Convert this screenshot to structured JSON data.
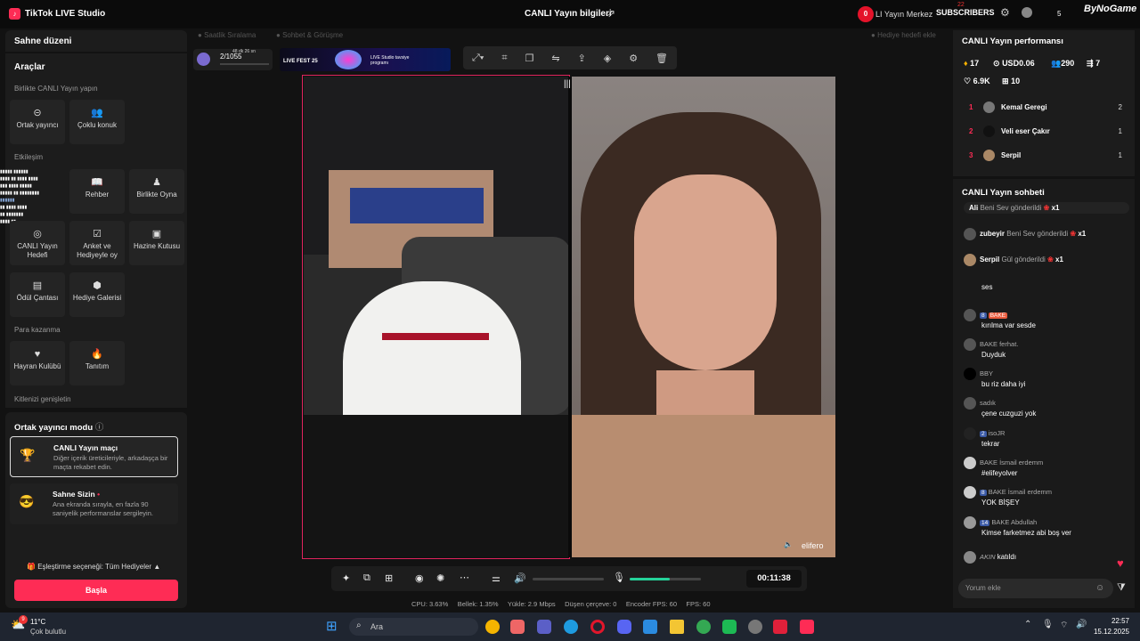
{
  "app": {
    "title": "TikTok LIVE Studio",
    "live_info": "CANLI Yayın bilgileri",
    "logo": "♪"
  },
  "overlay": {
    "notif": "0",
    "text": "LI Yayın Merkez",
    "subscribers": "SUBSCRIBERS",
    "count": "22",
    "sub_count": "5",
    "brand": "ByNoGame"
  },
  "left": {
    "scene": "Sahne düzeni",
    "tools": "Araçlar",
    "together": "Birlikte CANLI Yayın yapın",
    "co_host": "Ortak yayıncı",
    "multi_guest": "Çoklu konuk",
    "interaction": "Etkileşim",
    "guide": "Rehber",
    "play_together": "Birlikte Oyna",
    "live_goal": "CANLI Yayın Hedefi",
    "poll": "Anket ve Hediyeyle oy",
    "treasure": "Hazine Kutusu",
    "reward_bag": "Ödül Çantası",
    "gift_gallery": "Hediye Galerisi",
    "monetize": "Para kazanma",
    "fan_club": "Hayran Kulübü",
    "promote": "Tanıtım",
    "grow": "Kitlenizi genişletin"
  },
  "mode": {
    "title": "Ortak yayıncı modu",
    "card1_title": "CANLI Yayın maçı",
    "card1_desc": "Diğer içerik üreticileriyle, arkadaşça bir maçta rekabet edin.",
    "card2_title": "Sahne Sizin",
    "card2_desc": "Ana ekranda sırayla, en fazla 90 saniyelik performanslar sergileyin.",
    "pairing": "Eşleştirme seçeneği: Tüm Hediyeler",
    "start": "Başla"
  },
  "center": {
    "tab1": "Saatlik Sıralama",
    "tab2": "Sohbet & Görüşme",
    "gift_goal": "Hediye hedefi ekle",
    "progress": "2/1055",
    "timer_small": "48 dk 26 sn",
    "banner1": "LIVE FEST 25",
    "banner2": "LIVE Studio tavsiye programı",
    "guest_name": "elifero",
    "timer": "00:11:38"
  },
  "stats": {
    "cpu": "CPU:  3.63%",
    "mem": "Bellek:  1.35%",
    "load": "Yükle:  2.9 Mbps",
    "drop": "Düşen çerçeve:  0",
    "enc": "Encoder FPS:  60",
    "fps": "FPS:  60"
  },
  "perf": {
    "title": "CANLI Yayın performansı",
    "diamonds": "17",
    "usd": "USD0.06",
    "viewers": "290",
    "shares": "7",
    "likes": "6.9K",
    "gifts": "10",
    "ranking": [
      {
        "rank": "1",
        "name": "Kemal Geregi",
        "val": "2"
      },
      {
        "rank": "2",
        "name": "Veli eser Çakır",
        "val": "1"
      },
      {
        "rank": "3",
        "name": "Serpil",
        "val": "1"
      }
    ]
  },
  "chat": {
    "title": "CANLI Yayın sohbeti",
    "gifts": [
      {
        "user": "Ali",
        "text": "Beni Sev gönderildi",
        "mult": "x1"
      },
      {
        "user": "zubeyir",
        "text": "Beni Sev gönderildi",
        "mult": "x1"
      },
      {
        "user": "Serpil",
        "text": "Gül gönderildi",
        "mult": "x1"
      }
    ],
    "messages": [
      {
        "user": "",
        "text": "ses"
      },
      {
        "user": "BAKE",
        "text": "kırılma var sesde"
      },
      {
        "user": "BAKE ferhat.",
        "text": "Duyduk"
      },
      {
        "user": "BBY",
        "text": "bu riz daha iyi"
      },
      {
        "user": "sadık",
        "text": "çene cuzguzi yok"
      },
      {
        "user": "isoJR",
        "text": "tekrar"
      },
      {
        "user": "BAKE İsmail erdemm",
        "text": "#elifeyolver"
      },
      {
        "user": "BAKE İsmail erdemm",
        "text": "YOK BİŞEY"
      },
      {
        "user": "BAKE Abdullah",
        "text": "Kimse farketmez abi boş ver"
      },
      {
        "user": "AKIN",
        "text": "katıldı"
      }
    ],
    "badge_a": "8",
    "badge_b": "2",
    "badge_c": "14",
    "badge_d": "8",
    "placeholder": "Yorum ekle"
  },
  "taskbar": {
    "temp": "11°C",
    "weather": "Çok bulutlu",
    "search": "Ara",
    "time": "22:57",
    "date": "15.12.2025",
    "weather_badge": "9"
  }
}
